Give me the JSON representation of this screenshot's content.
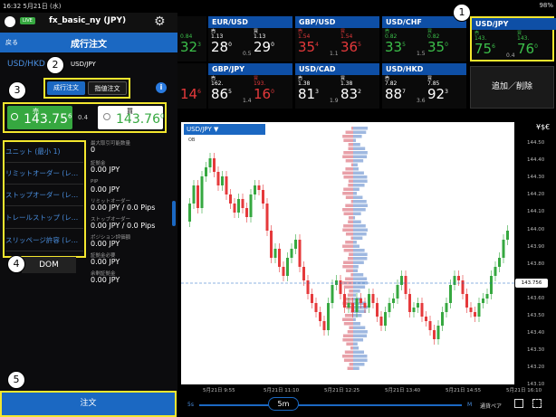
{
  "status": {
    "time_date": "16:32 5月21日 (水)",
    "battery": "98%"
  },
  "header": {
    "live": "LIVE",
    "account": "fx_basic_ny (JPY)"
  },
  "order": {
    "back": "戻る",
    "title": "成行注文",
    "pair_label": "USD/HKD",
    "pair_value": "USD/JPY",
    "type_market": "成行注文",
    "type_limit": "指値注文",
    "info": "i",
    "sell_label": "売",
    "sell_price": "143.75",
    "sell_sup": "6",
    "spread": "0.4",
    "buy_label": "買",
    "buy_price": "143.76",
    "buy_sup": "0",
    "options": [
      "ユニット (最小 1)",
      "リミットオーダー (レ…",
      "ストップオーダー (レ…",
      "トレールストップ (レ…",
      "スリッページ許容 (レ…"
    ],
    "dom": "DOM",
    "info_rows": [
      {
        "label": "最大取引可能数量",
        "value": "0"
      },
      {
        "label": "証拠金",
        "value": "0.00 JPY"
      },
      {
        "label": "PIP",
        "value": "0.00 JPY"
      },
      {
        "label": "リミットオーダー",
        "value": "0.00 JPY / 0.0 Pips"
      },
      {
        "label": "ストップオーダー",
        "value": "0.00 JPY / 0.0 Pips"
      },
      {
        "label": "ポジション評価額",
        "value": "0.00 JPY"
      },
      {
        "label": "証拠金必要",
        "value": "0.00 JPY"
      },
      {
        "label": "余剰証拠金",
        "value": "0.00 JPY"
      }
    ],
    "submit": "注文"
  },
  "markers": [
    "1",
    "2",
    "3",
    "4",
    "5"
  ],
  "tiles": [
    {
      "pair": "EUR/USD",
      "sl": "売",
      "bl": "買",
      "sp": "1.13",
      "bp": "1.13",
      "sb": "28",
      "ss": "0",
      "bb": "29",
      "bs": "0",
      "spread": "0.5",
      "cls": "white"
    },
    {
      "pair": "GBP/USD",
      "sl": "売",
      "bl": "買",
      "sp": "1.54",
      "bp": "1.54",
      "sb": "35",
      "ss": "4",
      "bb": "36",
      "bs": "5",
      "spread": "1.1",
      "cls": "red"
    },
    {
      "pair": "USD/CHF",
      "sl": "売",
      "bl": "買",
      "sp": "0.82",
      "bp": "0.82",
      "sb": "33",
      "ss": "5",
      "bb": "35",
      "bs": "0",
      "spread": "1.5",
      "cls": "green"
    },
    {
      "pair": "USD/JPY",
      "sl": "売",
      "bl": "買",
      "sp": "143.",
      "bp": "143.",
      "sb": "75",
      "ss": "6",
      "bb": "76",
      "bs": "0",
      "spread": "0.4",
      "cls": "green"
    },
    {
      "pair": "",
      "sl": "",
      "bl": "",
      "sp": "0.84",
      "bp": "",
      "sb": "32",
      "ss": "3",
      "bb": "",
      "bs": "",
      "spread": "",
      "cls": "green"
    },
    {
      "pair": "GBP/JPY",
      "sl": "売",
      "bl": "買",
      "sp": "162.",
      "bp": "193.",
      "sb": "86",
      "ss": "5",
      "bb": "16",
      "bs": "0",
      "spread": "1.4",
      "cls": "mixed"
    },
    {
      "pair": "USD/CAD",
      "sl": "売",
      "bl": "買",
      "sp": "1.38",
      "bp": "1.38",
      "sb": "81",
      "ss": "3",
      "bb": "83",
      "bs": "2",
      "spread": "1.9",
      "cls": "white"
    },
    {
      "pair": "USD/HKD",
      "sl": "売",
      "bl": "買",
      "sp": "7.82",
      "bp": "7.85",
      "sb": "88",
      "ss": "7",
      "bb": "92",
      "bs": "3",
      "spread": "3.6",
      "cls": "white"
    },
    {
      "pair": "",
      "sl": "",
      "bl": "",
      "sp": "",
      "bp": "",
      "sb": "14",
      "ss": "6",
      "bb": "",
      "bs": "",
      "spread": "",
      "cls": "red"
    }
  ],
  "add_remove": "追加／削除",
  "chart": {
    "pair": "USD/JPY",
    "ob": "OB",
    "currency_icon": "¥$€",
    "y_ticks": [
      "144.50",
      "144.40",
      "144.30",
      "144.20",
      "144.10",
      "144.00",
      "143.90",
      "143.80",
      "143.70",
      "143.60",
      "143.50",
      "143.40",
      "143.30",
      "143.20",
      "143.10"
    ],
    "x_ticks": [
      "5月21日 9:55",
      "5月21日 11:10",
      "5月21日 12:25",
      "5月21日 13:40",
      "5月21日 14:55",
      "5月21日 16:10"
    ],
    "current_price": "143.756",
    "tf_s": "5s",
    "tf": "5m",
    "tf_m": "M",
    "currency_pair": "通貨ペア"
  }
}
